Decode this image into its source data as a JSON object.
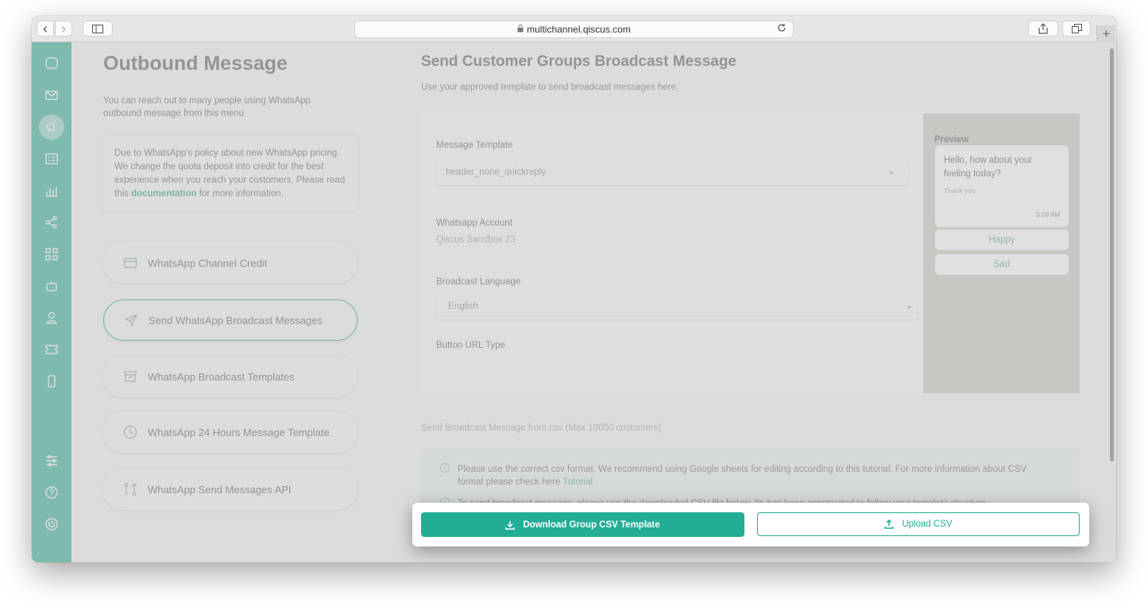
{
  "browser": {
    "url": "multichannel.qiscus.com",
    "back_glyph": "‹",
    "forward_glyph": "›",
    "new_tab_glyph": "+"
  },
  "left": {
    "title": "Outbound Message",
    "description": "You can reach out to many people using WhatsApp outbound message from this menu",
    "policy_text": "Due to WhatsApp's policy about new WhatsApp pricing. We change the quota deposit into credit for the best experience when you reach your customers. Please read this",
    "policy_link": "documentation",
    "policy_suffix": "for more information.",
    "menu": [
      {
        "label": "WhatsApp Channel Credit",
        "icon": "credit-card-icon"
      },
      {
        "label": "Send WhatsApp Broadcast Messages",
        "icon": "send-icon"
      },
      {
        "label": "WhatsApp Broadcast Templates",
        "icon": "archive-icon"
      },
      {
        "label": "WhatsApp 24 Hours Message Template",
        "icon": "clock-icon"
      },
      {
        "label": "WhatsApp Send Messages API",
        "icon": "api-icon"
      }
    ]
  },
  "right": {
    "title": "Send Customer Groups Broadcast Message",
    "description": "Use your approved template to send broadcast messages here.",
    "form": {
      "template_label": "Message Template",
      "template_value": "header_none_quickreply",
      "account_label": "Whatsapp Account",
      "account_value": "Qiscus Sandbox 23",
      "language_label": "Broadcast Language",
      "language_value": "English",
      "button_url_label": "Button URL Type",
      "chevron": "⌄"
    },
    "preview": {
      "title": "Preview",
      "body": "Hello, how about your feeling today?",
      "footer": "Thank you.",
      "time": "5:09 AM",
      "buttons": [
        "Happy",
        "Sad"
      ]
    },
    "csv_label": "Send Broadcast Message from csv (Max 10000 customers)",
    "info": {
      "line1": "Please use the correct csv format. We recommend using Google sheets for editing according to this tutorial. For more information about CSV format please check here",
      "line1_link": "Tutorial",
      "line2": "To send broadcast message, please use the downloaded CSV file below. Its has been constructed to follow your template structure.",
      "info_glyph": "i"
    }
  },
  "popup": {
    "download_label": "Download Group CSV Template",
    "upload_label": "Upload CSV"
  },
  "colors": {
    "sidebar": "#7fcbbd",
    "accent": "#23ad95"
  }
}
